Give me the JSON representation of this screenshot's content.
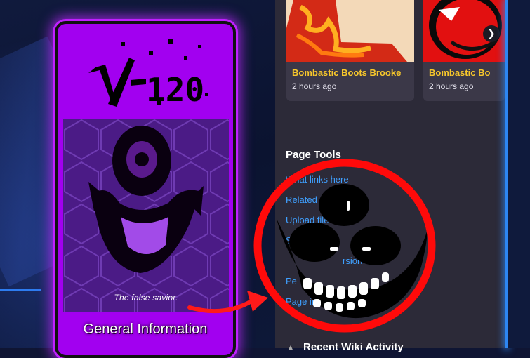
{
  "infobox": {
    "logo_text": "V-120",
    "caption": "The false savior.",
    "section_title": "General Information",
    "accent_color": "#a200f0"
  },
  "cards": [
    {
      "title": "Bombastic Boots Brooke",
      "time": "2 hours ago"
    },
    {
      "title": "Bombastic Bo",
      "time": "2 hours ago"
    }
  ],
  "carousel": {
    "next_icon": "chevron-right-icon",
    "next_glyph": "❯"
  },
  "page_tools": {
    "heading": "Page Tools",
    "links": [
      "What links here",
      "Related c",
      "Upload file",
      "Sp",
      "rsion",
      "Pe",
      "Page in"
    ]
  },
  "recent": {
    "heading": "Recent Wiki Activity"
  },
  "colors": {
    "link": "#3fa0ff",
    "card_title": "#f7c72b",
    "panel": "#2c2a38",
    "highlight_circle": "#ff0000"
  }
}
